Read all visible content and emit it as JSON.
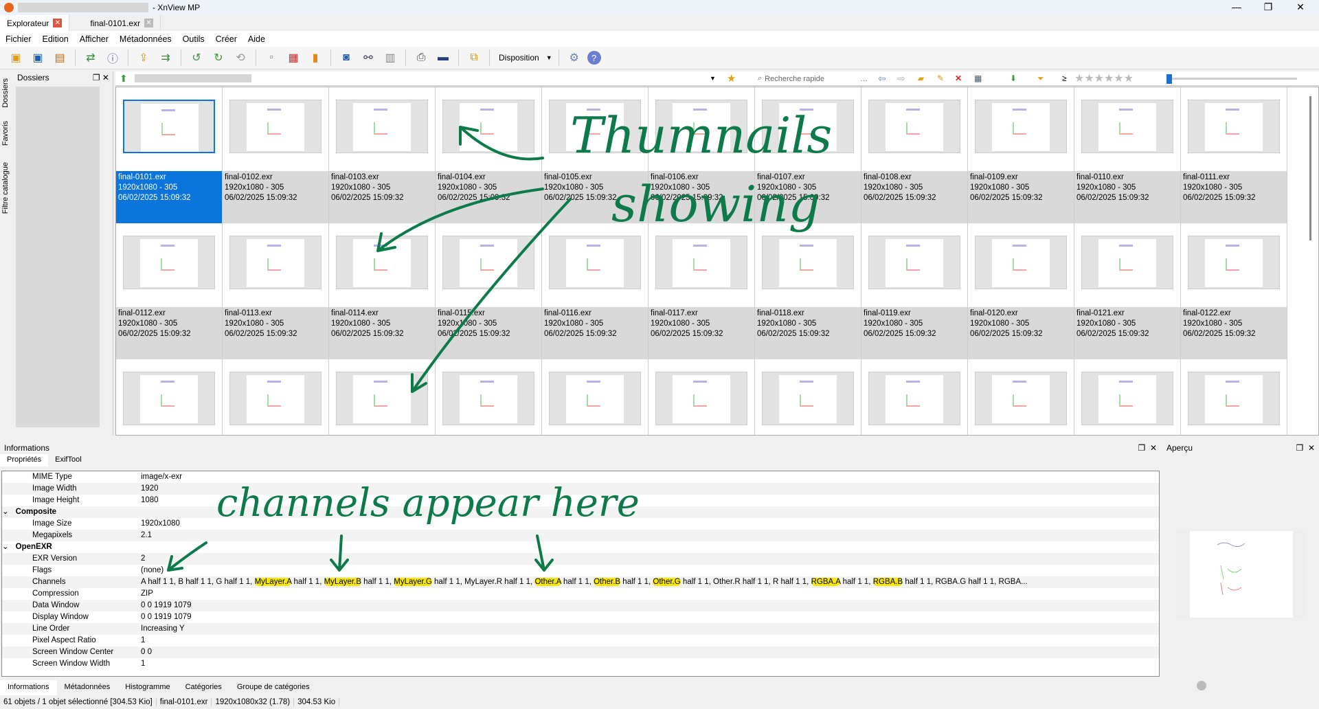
{
  "window": {
    "title": "- XnView MP",
    "min": "—",
    "max": "❐",
    "close": "✕"
  },
  "tabs": [
    {
      "label": "Explorateur"
    },
    {
      "label": "final-0101.exr"
    }
  ],
  "menu": [
    "Fichier",
    "Edition",
    "Afficher",
    "Métadonnées",
    "Outils",
    "Créer",
    "Aide"
  ],
  "toolbar": {
    "disposition": "Disposition"
  },
  "sidetabs": [
    "Dossiers",
    "Favoris",
    "Filtre catalogue"
  ],
  "dossiers": {
    "title": "Dossiers"
  },
  "search": {
    "placeholder": "Recherche rapide"
  },
  "files": [
    {
      "name": "final-0101.exr",
      "dim": "1920x1080 - 305",
      "date": "06/02/2025 15:09:32"
    },
    {
      "name": "final-0102.exr",
      "dim": "1920x1080 - 305",
      "date": "06/02/2025 15:09:32"
    },
    {
      "name": "final-0103.exr",
      "dim": "1920x1080 - 305",
      "date": "06/02/2025 15:09:32"
    },
    {
      "name": "final-0104.exr",
      "dim": "1920x1080 - 305",
      "date": "06/02/2025 15:09:32"
    },
    {
      "name": "final-0105.exr",
      "dim": "1920x1080 - 305",
      "date": "06/02/2025 15:09:32"
    },
    {
      "name": "final-0106.exr",
      "dim": "1920x1080 - 305",
      "date": "06/02/2025 15:09:32"
    },
    {
      "name": "final-0107.exr",
      "dim": "1920x1080 - 305",
      "date": "06/02/2025 15:09:32"
    },
    {
      "name": "final-0108.exr",
      "dim": "1920x1080 - 305",
      "date": "06/02/2025 15:09:32"
    },
    {
      "name": "final-0109.exr",
      "dim": "1920x1080 - 305",
      "date": "06/02/2025 15:09:32"
    },
    {
      "name": "final-0110.exr",
      "dim": "1920x1080 - 305",
      "date": "06/02/2025 15:09:32"
    },
    {
      "name": "final-0111.exr",
      "dim": "1920x1080 - 305",
      "date": "06/02/2025 15:09:32"
    },
    {
      "name": "final-0112.exr",
      "dim": "1920x1080 - 305",
      "date": "06/02/2025 15:09:32"
    },
    {
      "name": "final-0113.exr",
      "dim": "1920x1080 - 305",
      "date": "06/02/2025 15:09:32"
    },
    {
      "name": "final-0114.exr",
      "dim": "1920x1080 - 305",
      "date": "06/02/2025 15:09:32"
    },
    {
      "name": "final-0115.exr",
      "dim": "1920x1080 - 305",
      "date": "06/02/2025 15:09:32"
    },
    {
      "name": "final-0116.exr",
      "dim": "1920x1080 - 305",
      "date": "06/02/2025 15:09:32"
    },
    {
      "name": "final-0117.exr",
      "dim": "1920x1080 - 305",
      "date": "06/02/2025 15:09:32"
    },
    {
      "name": "final-0118.exr",
      "dim": "1920x1080 - 305",
      "date": "06/02/2025 15:09:32"
    },
    {
      "name": "final-0119.exr",
      "dim": "1920x1080 - 305",
      "date": "06/02/2025 15:09:32"
    },
    {
      "name": "final-0120.exr",
      "dim": "1920x1080 - 305",
      "date": "06/02/2025 15:09:32"
    },
    {
      "name": "final-0121.exr",
      "dim": "1920x1080 - 305",
      "date": "06/02/2025 15:09:32"
    },
    {
      "name": "final-0122.exr",
      "dim": "1920x1080 - 305",
      "date": "06/02/2025 15:09:32"
    }
  ],
  "info": {
    "title": "Informations",
    "tabs": [
      "Propriétés",
      "ExifTool"
    ],
    "rows": [
      {
        "k": "MIME Type",
        "v": "image/x-exr"
      },
      {
        "k": "Image Width",
        "v": "1920"
      },
      {
        "k": "Image Height",
        "v": "1080"
      },
      {
        "group": "Composite"
      },
      {
        "k": "Image Size",
        "v": "1920x1080"
      },
      {
        "k": "Megapixels",
        "v": "2.1"
      },
      {
        "group": "OpenEXR"
      },
      {
        "k": "EXR Version",
        "v": "2"
      },
      {
        "k": "Flags",
        "v": "(none)"
      },
      {
        "k": "Channels",
        "segments": [
          {
            "t": "A half 1 1, B half 1 1, G half 1 1, "
          },
          {
            "t": "MyLayer.A",
            "h": true
          },
          {
            "t": " half 1 1, "
          },
          {
            "t": "MyLayer.B",
            "h": true
          },
          {
            "t": " half 1 1, "
          },
          {
            "t": "MyLayer.G",
            "h": true
          },
          {
            "t": " half 1 1, MyLayer.R half 1 1, "
          },
          {
            "t": "Other.A",
            "h": true
          },
          {
            "t": " half 1 1, "
          },
          {
            "t": "Other.B",
            "h": true
          },
          {
            "t": " half 1 1, "
          },
          {
            "t": "Other.G",
            "h": true
          },
          {
            "t": " half 1 1, Other.R half 1 1, R half 1 1, "
          },
          {
            "t": "RGBA.A",
            "h": true
          },
          {
            "t": " half 1 1, "
          },
          {
            "t": "RGBA.B",
            "h": true
          },
          {
            "t": " half 1 1, RGBA.G half 1 1, RGBA..."
          }
        ]
      },
      {
        "k": "Compression",
        "v": "ZIP"
      },
      {
        "k": "Data Window",
        "v": "0 0 1919 1079"
      },
      {
        "k": "Display Window",
        "v": "0 0 1919 1079"
      },
      {
        "k": "Line Order",
        "v": "Increasing Y"
      },
      {
        "k": "Pixel Aspect Ratio",
        "v": "1"
      },
      {
        "k": "Screen Window Center",
        "v": "0 0"
      },
      {
        "k": "Screen Window Width",
        "v": "1"
      }
    ]
  },
  "bottom_tabs": [
    "Informations",
    "Métadonnées",
    "Histogramme",
    "Catégories",
    "Groupe de catégories"
  ],
  "status": [
    "61 objets / 1 objet sélectionné [304.53 Kio]",
    "final-0101.exr",
    "1920x1080x32 (1.78)",
    "304.53 Kio"
  ],
  "apercu": {
    "title": "Aperçu"
  },
  "annotations": {
    "thumbs1": "Thumnails",
    "thumbs2": "showing",
    "channels": "channels appear here"
  }
}
